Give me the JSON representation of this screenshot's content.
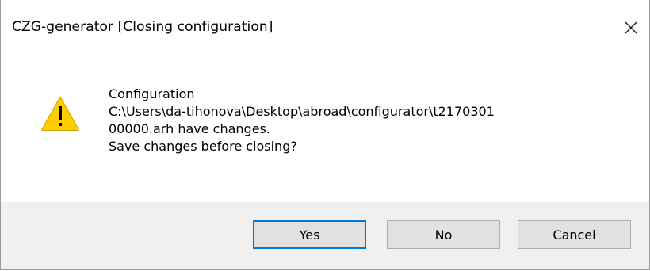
{
  "window": {
    "title": "CZG-generator [Closing configuration]",
    "close_icon": "close-icon"
  },
  "message": {
    "icon": "warning-icon",
    "lines": [
      "Configuration",
      "C:\\Users\\da-tihonova\\Desktop\\abroad\\configurator\\t2170301",
      "00000.arh have changes.",
      "Save changes before closing?"
    ]
  },
  "buttons": {
    "yes_label": "Yes",
    "no_label": "No",
    "cancel_label": "Cancel"
  },
  "colors": {
    "accent": "#0078d7",
    "warning_fill": "#ffcc00",
    "footer_bg": "#f0f0f0",
    "button_bg": "#e1e1e1"
  }
}
